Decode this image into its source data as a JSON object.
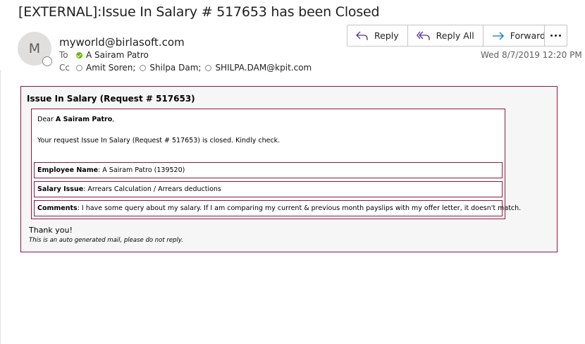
{
  "email": {
    "subject": "[EXTERNAL]:Issue In Salary # 517653 has been Closed",
    "avatar_initial": "M",
    "sender": "myworld@birlasoft.com",
    "to_label": "To",
    "to": "A Sairam Patro",
    "cc_label": "Cc",
    "cc": [
      "Amit Soren;",
      "Shilpa Dam;",
      "SHILPA.DAM@kpit.com"
    ],
    "date": "Wed 8/7/2019 12:20 PM"
  },
  "actions": {
    "reply": "Reply",
    "reply_all": "Reply All",
    "forward": "Forward"
  },
  "body": {
    "title": "Issue In Salary (Request # 517653)",
    "greeting_prefix": "Dear ",
    "greeting_name": "A Sairam Patro",
    "greeting_suffix": ",",
    "message": "Your request Issue In Salary (Request # 517653) is closed. Kindly check.",
    "fields": [
      {
        "label": "Employee Name",
        "value": ": A Sairam Patro (139520)"
      },
      {
        "label": "Salary Issue",
        "value": ": Arrears Calculation / Arrears deductions"
      },
      {
        "label": "Comments",
        "value": ": I have some query about my salary. If I am comparing my current & previous month payslips with my offer letter, it doesn't match."
      }
    ],
    "thanks": "Thank you!",
    "auto_note": "This is an auto generated mail, please do not reply."
  },
  "colors": {
    "accent": "#0078d4",
    "border": "#8b1a3a",
    "presence_available": "#6bb700"
  },
  "icons": [
    "reply-icon",
    "reply-all-icon",
    "forward-icon",
    "more-icon",
    "presence-available-icon",
    "presence-unknown-icon"
  ]
}
